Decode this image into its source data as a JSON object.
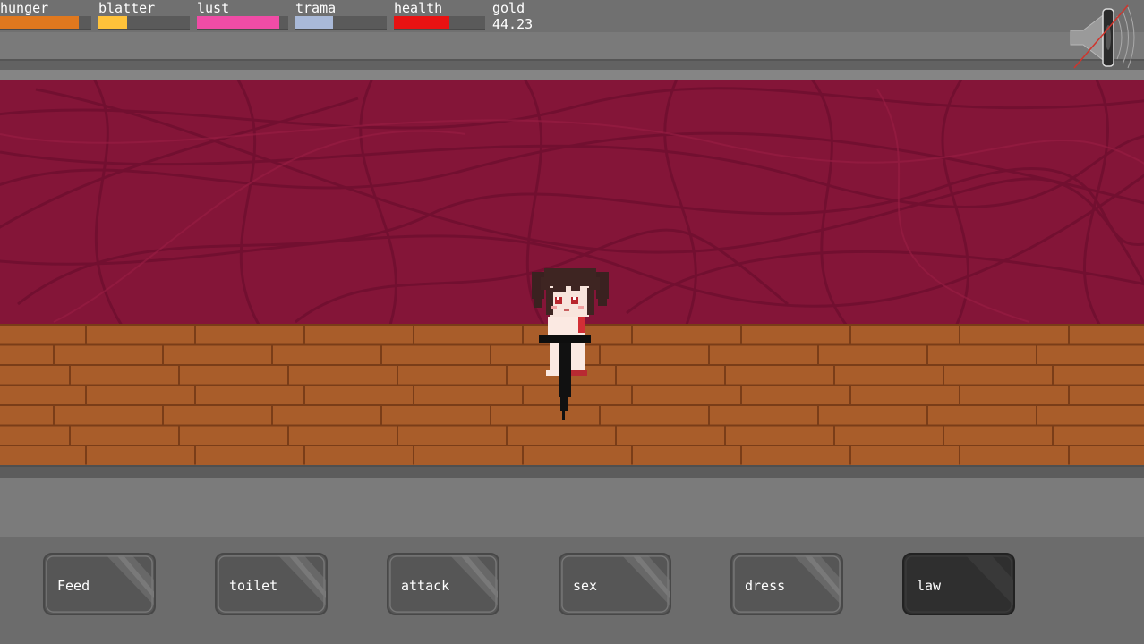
{
  "hud": {
    "stats": [
      {
        "label": "hunger",
        "fill": 0.86,
        "color": "#e0781e"
      },
      {
        "label": "blatter",
        "fill": 0.31,
        "color": "#ffc23a"
      },
      {
        "label": "lust",
        "fill": 0.9,
        "color": "#f04ca6"
      },
      {
        "label": "trama",
        "fill": 0.41,
        "color": "#a9b9d8"
      },
      {
        "label": "health",
        "fill": 0.61,
        "color": "#e81212"
      }
    ],
    "gold_label": "gold",
    "gold_value": "44.23",
    "mute_icon": "speaker-muted-icon"
  },
  "scene": {
    "wall_color": "#841538",
    "floor_color": "#a95d2a",
    "character": "chibi-girl-sprite"
  },
  "actions": [
    {
      "label": "Feed"
    },
    {
      "label": "toilet"
    },
    {
      "label": "attack"
    },
    {
      "label": "sex"
    },
    {
      "label": "dress"
    },
    {
      "label": "law",
      "active": true
    }
  ]
}
